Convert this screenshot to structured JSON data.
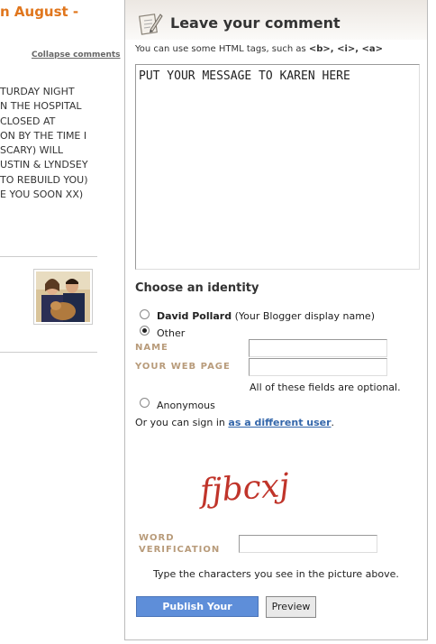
{
  "left": {
    "post_title": "n August -",
    "collapse_label": "Collapse comments",
    "comment_lines": [
      "TURDAY NIGHT",
      "N THE HOSPITAL",
      " CLOSED AT",
      "ON BY THE TIME I",
      "SCARY) WILL",
      "USTIN & LYNDSEY",
      "TO REBUILD YOU)",
      "E YOU SOON XX)"
    ],
    "avatar_icon": "couple-with-dog-photo"
  },
  "panel": {
    "title": "Leave your comment",
    "title_icon": "pen-paper-icon",
    "html_hint_prefix": "You can use some HTML tags, such as ",
    "html_hint_tags": "<b>, <i>, <a>",
    "comment_value": "PUT YOUR MESSAGE TO KAREN HERE",
    "identity_title": "Choose an identity",
    "identity_options": [
      {
        "name": "David Pollard",
        "detail": " (Your Blogger display name)",
        "checked": false
      },
      {
        "name": "",
        "detail": "Other",
        "checked": true
      },
      {
        "name": "",
        "detail": "Anonymous",
        "checked": false
      }
    ],
    "name_label": "NAME",
    "webpage_label": "YOUR WEB PAGE",
    "optional_note": "All of these fields are optional.",
    "signin_prefix": "Or you can sign in ",
    "signin_link": "as a different user",
    "signin_suffix": ".",
    "captcha_text": "fjbcxj",
    "word_verification_label_1": "WORD",
    "word_verification_label_2": "VERIFICATION",
    "captcha_instructions": "Type the characters you see in the picture above.",
    "publish_label": "Publish Your Comment",
    "preview_label": "Preview"
  }
}
